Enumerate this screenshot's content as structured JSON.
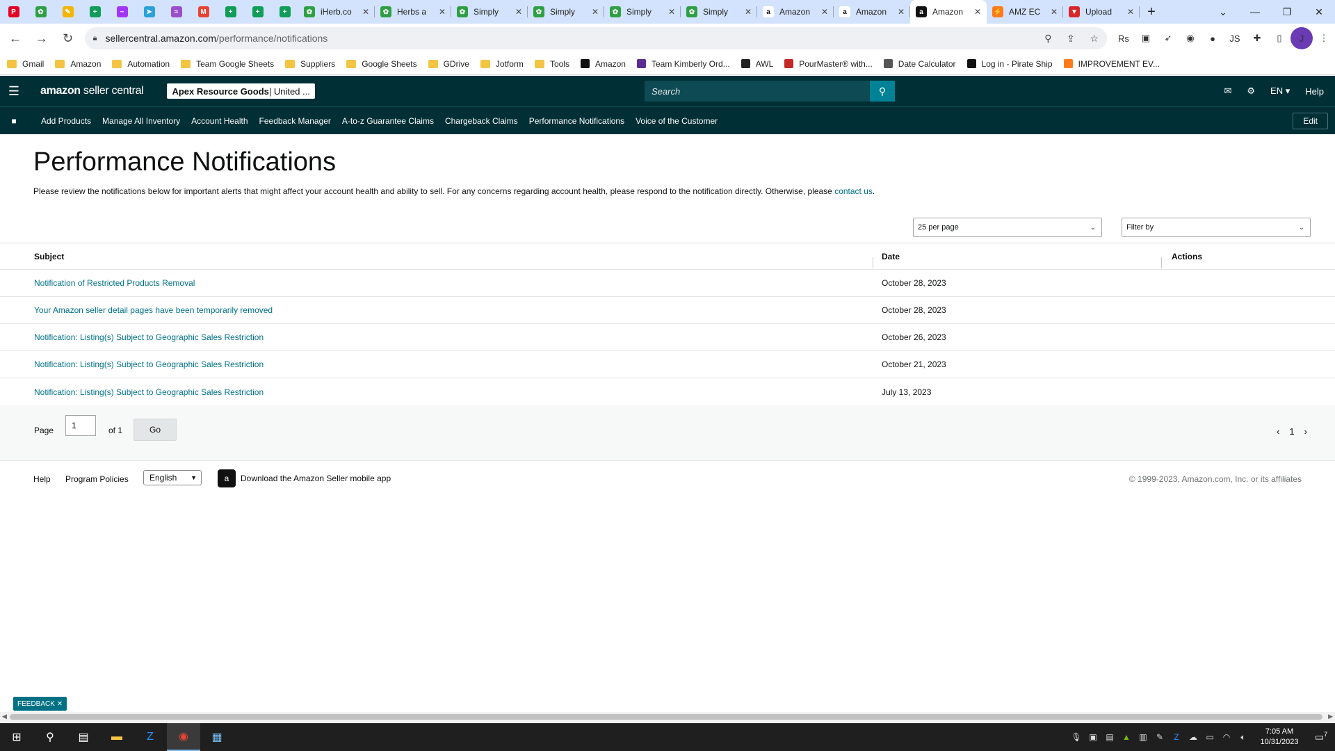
{
  "browser": {
    "pinned_tabs": [
      {
        "icon": "pinterest-icon",
        "color": "#e60023",
        "glyph": "P"
      },
      {
        "icon": "leaf-icon",
        "color": "#2ea043",
        "glyph": "✿"
      },
      {
        "icon": "pen-icon",
        "color": "#f4b400",
        "glyph": "✎"
      },
      {
        "icon": "sheets-icon",
        "color": "#0f9d58",
        "glyph": "+"
      },
      {
        "icon": "messenger-icon",
        "color": "#a334fa",
        "glyph": "~"
      },
      {
        "icon": "telegram-icon",
        "color": "#2aa1da",
        "glyph": "➤"
      },
      {
        "icon": "signature-icon",
        "color": "#9c4dcc",
        "glyph": "≈"
      },
      {
        "icon": "gmail-icon",
        "color": "#ea4335",
        "glyph": "M"
      },
      {
        "icon": "sheets-icon",
        "color": "#0f9d58",
        "glyph": "+"
      },
      {
        "icon": "sheets-icon",
        "color": "#0f9d58",
        "glyph": "+"
      },
      {
        "icon": "sheets-icon",
        "color": "#0f9d58",
        "glyph": "+"
      }
    ],
    "tabs": [
      {
        "label": "iHerb.co",
        "icon": "leaf-icon",
        "color": "#2ea043",
        "glyph": "✿"
      },
      {
        "label": "Herbs a",
        "icon": "leaf-icon",
        "color": "#2ea043",
        "glyph": "✿"
      },
      {
        "label": "Simply",
        "icon": "leaf-icon",
        "color": "#2ea043",
        "glyph": "✿"
      },
      {
        "label": "Simply",
        "icon": "leaf-icon",
        "color": "#2ea043",
        "glyph": "✿"
      },
      {
        "label": "Simply",
        "icon": "leaf-icon",
        "color": "#2ea043",
        "glyph": "✿"
      },
      {
        "label": "Simply",
        "icon": "leaf-icon",
        "color": "#2ea043",
        "glyph": "✿"
      },
      {
        "label": "Amazon",
        "icon": "amazon-icon",
        "color": "#ffffff",
        "glyph": "a"
      },
      {
        "label": "Amazon",
        "icon": "amazon-icon",
        "color": "#ffffff",
        "glyph": "a"
      },
      {
        "label": "Amazon",
        "icon": "amazon-icon",
        "color": "#111111",
        "glyph": "a",
        "active": true
      },
      {
        "label": "AMZ EC",
        "icon": "chart-icon",
        "color": "#ff7a1a",
        "glyph": "⚡"
      },
      {
        "label": "Upload",
        "icon": "upload-icon",
        "color": "#d62828",
        "glyph": "▼"
      }
    ],
    "new_tab_glyph": "+",
    "address": {
      "host": "sellercentral.amazon.com",
      "path": "/performance/notifications"
    },
    "bookmarks": [
      {
        "label": "Gmail",
        "kind": "folder"
      },
      {
        "label": "Amazon",
        "kind": "folder"
      },
      {
        "label": "Automation",
        "kind": "folder"
      },
      {
        "label": "Team Google Sheets",
        "kind": "folder"
      },
      {
        "label": "Suppliers",
        "kind": "folder"
      },
      {
        "label": "Google Sheets",
        "kind": "folder"
      },
      {
        "label": "GDrive",
        "kind": "folder"
      },
      {
        "label": "Jotform",
        "kind": "folder"
      },
      {
        "label": "Tools",
        "kind": "folder"
      },
      {
        "label": "Amazon",
        "kind": "site",
        "color": "#111111"
      },
      {
        "label": "Team Kimberly Ord...",
        "kind": "site",
        "color": "#5b2c91"
      },
      {
        "label": "AWL",
        "kind": "site",
        "color": "#222222"
      },
      {
        "label": "PourMaster® with...",
        "kind": "site",
        "color": "#c62828"
      },
      {
        "label": "Date Calculator",
        "kind": "site",
        "color": "#555555"
      },
      {
        "label": "Log in - Pirate Ship",
        "kind": "site",
        "color": "#111111"
      },
      {
        "label": "IMPROVEMENT EV...",
        "kind": "site",
        "color": "#ff7a1a"
      }
    ],
    "avatar_letter": "J"
  },
  "header": {
    "logo_bold": "amazon",
    "logo_light": " seller central",
    "store_name": "Apex Resource Goods",
    "store_region": " | United ...",
    "search_placeholder": "Search",
    "language": "EN",
    "help": "Help",
    "nav_links": [
      "Add Products",
      "Manage All Inventory",
      "Account Health",
      "Feedback Manager",
      "A-to-z Guarantee Claims",
      "Chargeback Claims",
      "Performance Notifications",
      "Voice of the Customer"
    ],
    "edit": "Edit"
  },
  "page": {
    "title": "Performance Notifications",
    "intro": "Please review the notifications below for important alerts that might affect your account health and ability to sell. For any concerns regarding account health, please respond to the notification directly. Otherwise, please ",
    "intro_link": "contact us",
    "intro_end": ".",
    "per_page": "25 per page",
    "filter_placeholder": "Filter by",
    "columns": {
      "subject": "Subject",
      "date": "Date",
      "actions": "Actions"
    },
    "rows": [
      {
        "subject": "Notification of Restricted Products Removal",
        "date": "October 28, 2023"
      },
      {
        "subject": "Your Amazon seller detail pages have been temporarily removed",
        "date": "October 28, 2023"
      },
      {
        "subject": "Notification: Listing(s) Subject to Geographic Sales Restriction",
        "date": "October 26, 2023"
      },
      {
        "subject": "Notification: Listing(s) Subject to Geographic Sales Restriction",
        "date": "October 21, 2023"
      },
      {
        "subject": "Notification: Listing(s) Subject to Geographic Sales Restriction",
        "date": "July 13, 2023"
      }
    ],
    "pager": {
      "label": "Page",
      "value": "1",
      "of": "of 1",
      "go": "Go",
      "current": "1"
    }
  },
  "footer": {
    "help": "Help",
    "policies": "Program Policies",
    "language": "English",
    "app_text": "Download the Amazon Seller mobile app",
    "copyright": "© 1999-2023, Amazon.com, Inc. or its affiliates"
  },
  "feedback": "FEEDBACK",
  "taskbar": {
    "time": "7:05 AM",
    "date": "10/31/2023",
    "notifications": "7"
  }
}
